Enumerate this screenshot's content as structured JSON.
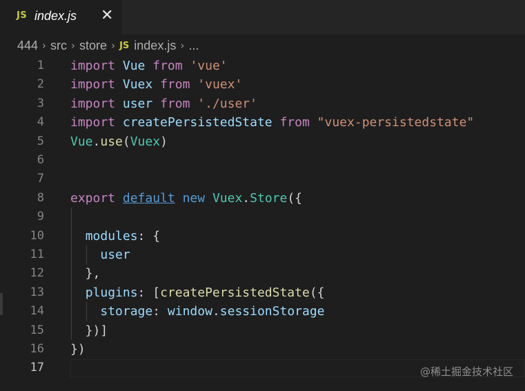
{
  "tab": {
    "icon_text": "JS",
    "label": "index.js",
    "close_glyph": "✕"
  },
  "breadcrumb": {
    "items": [
      "444",
      "src",
      "store"
    ],
    "file_icon_text": "JS",
    "file": "index.js",
    "more": "..."
  },
  "editor": {
    "line_numbers": [
      "1",
      "2",
      "3",
      "4",
      "5",
      "6",
      "7",
      "8",
      "9",
      "10",
      "11",
      "12",
      "13",
      "14",
      "15",
      "16",
      "17"
    ],
    "active_line": "17",
    "lines": [
      [
        {
          "t": "import",
          "c": "kw"
        },
        {
          "t": " "
        },
        {
          "t": "Vue",
          "c": "id"
        },
        {
          "t": " "
        },
        {
          "t": "from",
          "c": "kw"
        },
        {
          "t": " "
        },
        {
          "t": "'vue'",
          "c": "str"
        }
      ],
      [
        {
          "t": "import",
          "c": "kw"
        },
        {
          "t": " "
        },
        {
          "t": "Vuex",
          "c": "id"
        },
        {
          "t": " "
        },
        {
          "t": "from",
          "c": "kw"
        },
        {
          "t": " "
        },
        {
          "t": "'vuex'",
          "c": "str"
        }
      ],
      [
        {
          "t": "import",
          "c": "kw"
        },
        {
          "t": " "
        },
        {
          "t": "user",
          "c": "id"
        },
        {
          "t": " "
        },
        {
          "t": "from",
          "c": "kw"
        },
        {
          "t": " "
        },
        {
          "t": "'./user'",
          "c": "str"
        }
      ],
      [
        {
          "t": "import",
          "c": "kw"
        },
        {
          "t": " "
        },
        {
          "t": "createPersistedState",
          "c": "id"
        },
        {
          "t": " "
        },
        {
          "t": "from",
          "c": "kw"
        },
        {
          "t": " "
        },
        {
          "t": "\"vuex-persistedstate\"",
          "c": "str"
        }
      ],
      [
        {
          "t": "Vue",
          "c": "cls"
        },
        {
          "t": "."
        },
        {
          "t": "use",
          "c": "fn"
        },
        {
          "t": "("
        },
        {
          "t": "Vuex",
          "c": "cls"
        },
        {
          "t": ")"
        }
      ],
      [],
      [],
      [
        {
          "t": "export",
          "c": "kw"
        },
        {
          "t": " "
        },
        {
          "t": "default",
          "c": "def"
        },
        {
          "t": " "
        },
        {
          "t": "new",
          "c": "new"
        },
        {
          "t": " "
        },
        {
          "t": "Vuex",
          "c": "cls"
        },
        {
          "t": "."
        },
        {
          "t": "Store",
          "c": "cls"
        },
        {
          "t": "({"
        }
      ],
      [],
      [
        {
          "t": "  "
        },
        {
          "t": "modules",
          "c": "id"
        },
        {
          "t": ": {"
        }
      ],
      [
        {
          "t": "    "
        },
        {
          "t": "user",
          "c": "id"
        }
      ],
      [
        {
          "t": "  },"
        }
      ],
      [
        {
          "t": "  "
        },
        {
          "t": "plugins",
          "c": "id"
        },
        {
          "t": ": ["
        },
        {
          "t": "createPersistedState",
          "c": "fn"
        },
        {
          "t": "({"
        }
      ],
      [
        {
          "t": "    "
        },
        {
          "t": "storage",
          "c": "id"
        },
        {
          "t": ": "
        },
        {
          "t": "window",
          "c": "id"
        },
        {
          "t": "."
        },
        {
          "t": "sessionStorage",
          "c": "id"
        }
      ],
      [
        {
          "t": "  })]"
        }
      ],
      [
        {
          "t": "})"
        }
      ],
      []
    ]
  },
  "watermark": "@稀土掘金技术社区",
  "colors": {
    "background": "#1e1e1e",
    "tabbar": "#252526",
    "keyword": "#c586c0",
    "variable": "#9cdcfe",
    "string": "#ce9178",
    "class": "#4ec9b0",
    "function": "#dcdcaa",
    "storage": "#569cd6"
  }
}
